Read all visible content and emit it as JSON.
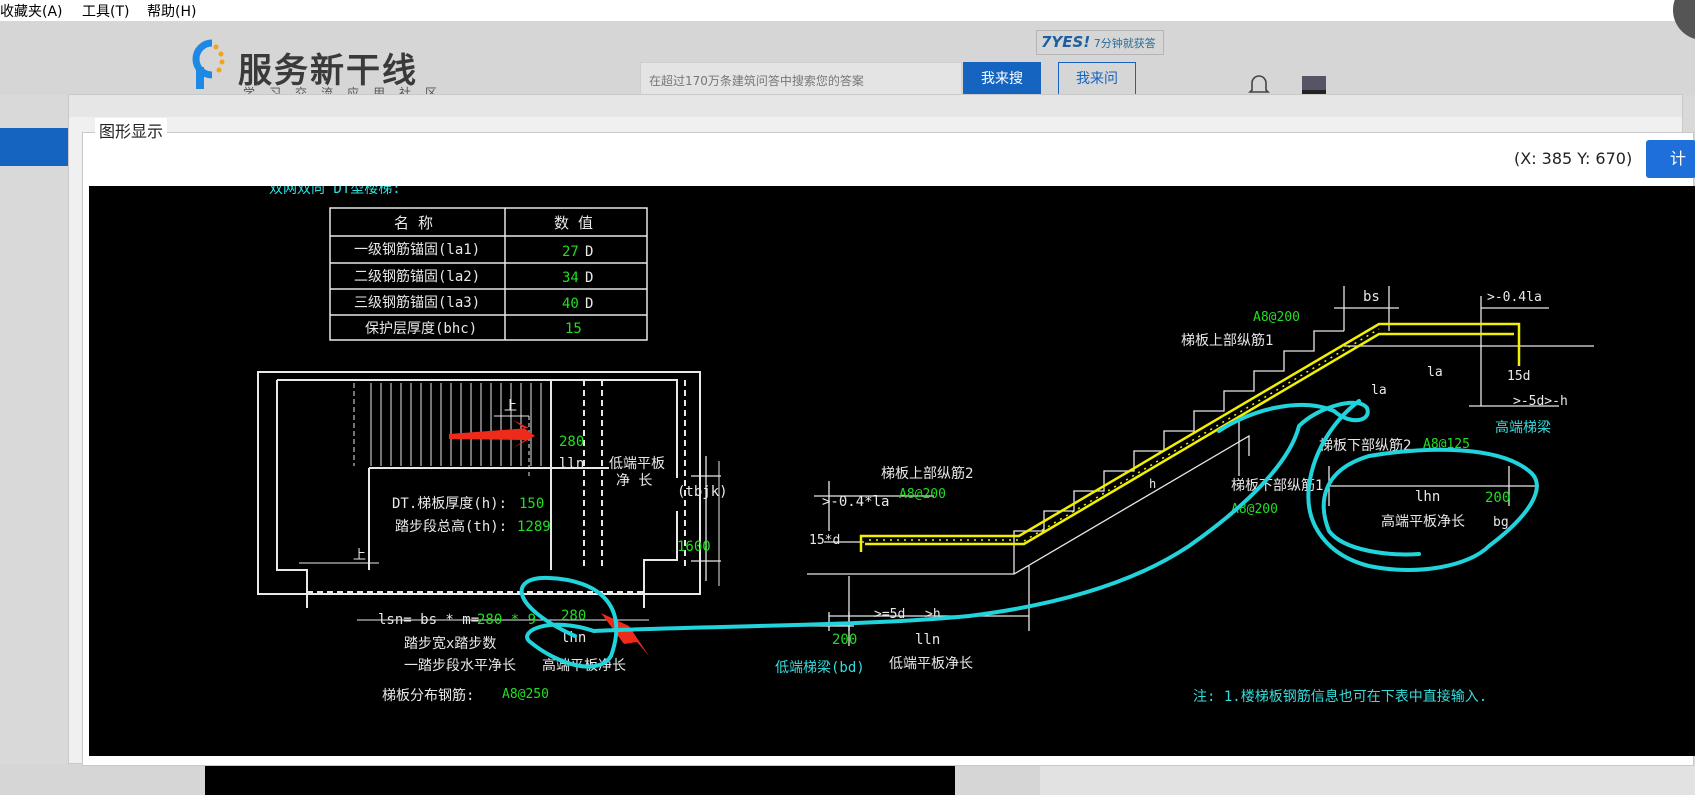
{
  "menu": {
    "favorites": "收藏夹(A)",
    "tools": "工具(T)",
    "help": "帮助(H)"
  },
  "site": {
    "logo_text": "服务新干线",
    "logo_sub": "学习交流应用社区",
    "yes_badge_brand": "7YES!",
    "yes_badge_text": "7分钟就获答",
    "search_placeholder": "在超过170万条建筑问答中搜索您的答案",
    "search_button": "我来搜",
    "ask_button": "我来问"
  },
  "panel": {
    "legend": "图形显示",
    "coords": "(X: 385 Y: 670)",
    "calc_button": "计"
  },
  "drawing": {
    "header_partial": "双网双向  DT型楼梯:",
    "table_headers": [
      "名  称",
      "数  值"
    ],
    "table_rows": [
      {
        "name": "一级钢筋锚固(la1)",
        "value": "27",
        "unit": "D"
      },
      {
        "name": "二级钢筋锚固(la2)",
        "value": "34",
        "unit": "D"
      },
      {
        "name": "三级钢筋锚固(la3)",
        "value": "40",
        "unit": "D"
      },
      {
        "name": "保护层厚度(bhc)",
        "value": "15",
        "unit": ""
      }
    ],
    "plan": {
      "thickness_label": "DT.梯板厚度(h):",
      "thickness_value": "150",
      "height_label": "踏步段总高(th):",
      "height_value": "1289",
      "v280_top": "280",
      "lln_top": "lln",
      "low_slab_1": "低端平板",
      "low_slab_2": "净  长",
      "up_mark": "上",
      "lsn_label": "lsn= bs * m=",
      "lsn_value": "280 * 9",
      "v280_bottom": "280",
      "lhn_bottom": "lhn",
      "step_desc": "踏步宽x踏步数",
      "step_horiz": "一踏步段水平净长",
      "high_slab_net_partial": "高端平板净长",
      "dist_rebar_label": "梯板分布钢筋:",
      "dist_rebar_value": "A8@250"
    },
    "section": {
      "tbjk": "(tbjk)",
      "v1600": "1600",
      "a_04la": ">-0.4*la",
      "a15d": "15*d",
      "top_rebar2": "梯板上部纵筋2",
      "top_rebar2_value": "A8@200",
      "a5d": ">=5d",
      "ah": ">h",
      "v200_left": "200",
      "lln_left": "lln",
      "low_beam": "低端梯梁(bd)",
      "low_slab_net": "低端平板净长",
      "top_rebar1_value": "A8@200",
      "top_rebar1": "梯板上部纵筋1",
      "bs": "bs",
      "a04la_right": ">-0.4la",
      "la": "la",
      "la_left": "la",
      "v15d": "15d",
      "a5dh": ">-5d>-h",
      "high_beam": "高端梯梁",
      "mid_rebar": "梯板下部纵筋2",
      "mid_rebar_value": "A8@125",
      "bot_rebar": "梯板下部纵筋1",
      "bot_rebar_value": "A8@200",
      "h_mark": "h",
      "lhn": "lhn",
      "v200_right": "200",
      "high_slab_net": "高端平板净长",
      "bg": "bg"
    },
    "note": "注: 1.楼梯板钢筋信息也可在下表中直接输入."
  },
  "colors": {
    "canvas": "#000000",
    "cad_white": "#e8e8e8",
    "cad_green": "#22dd22",
    "cad_cyan": "#33dddd",
    "cad_yellow": "#f0f000",
    "annotation_cyan": "#21d4dc",
    "arrow_red": "#ee2a1a",
    "brand_blue": "#1565c0"
  }
}
